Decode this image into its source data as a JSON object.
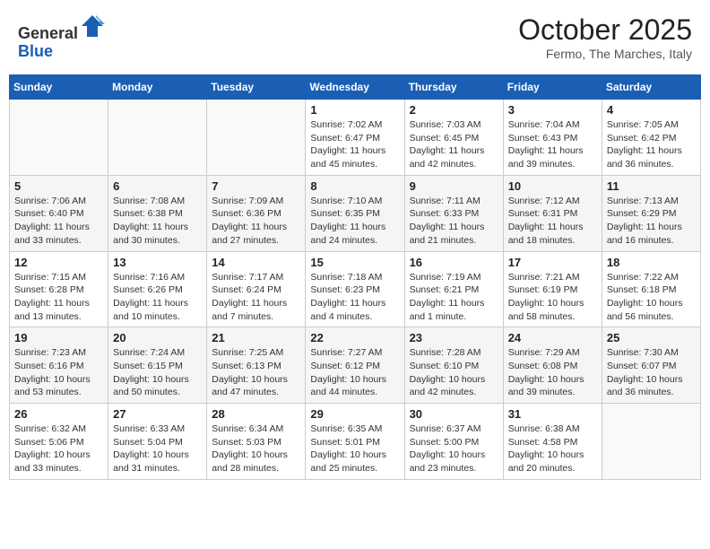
{
  "header": {
    "logo_line1": "General",
    "logo_line2": "Blue",
    "month": "October 2025",
    "location": "Fermo, The Marches, Italy"
  },
  "weekdays": [
    "Sunday",
    "Monday",
    "Tuesday",
    "Wednesday",
    "Thursday",
    "Friday",
    "Saturday"
  ],
  "weeks": [
    [
      {
        "day": "",
        "info": ""
      },
      {
        "day": "",
        "info": ""
      },
      {
        "day": "",
        "info": ""
      },
      {
        "day": "1",
        "info": "Sunrise: 7:02 AM\nSunset: 6:47 PM\nDaylight: 11 hours and 45 minutes."
      },
      {
        "day": "2",
        "info": "Sunrise: 7:03 AM\nSunset: 6:45 PM\nDaylight: 11 hours and 42 minutes."
      },
      {
        "day": "3",
        "info": "Sunrise: 7:04 AM\nSunset: 6:43 PM\nDaylight: 11 hours and 39 minutes."
      },
      {
        "day": "4",
        "info": "Sunrise: 7:05 AM\nSunset: 6:42 PM\nDaylight: 11 hours and 36 minutes."
      }
    ],
    [
      {
        "day": "5",
        "info": "Sunrise: 7:06 AM\nSunset: 6:40 PM\nDaylight: 11 hours and 33 minutes."
      },
      {
        "day": "6",
        "info": "Sunrise: 7:08 AM\nSunset: 6:38 PM\nDaylight: 11 hours and 30 minutes."
      },
      {
        "day": "7",
        "info": "Sunrise: 7:09 AM\nSunset: 6:36 PM\nDaylight: 11 hours and 27 minutes."
      },
      {
        "day": "8",
        "info": "Sunrise: 7:10 AM\nSunset: 6:35 PM\nDaylight: 11 hours and 24 minutes."
      },
      {
        "day": "9",
        "info": "Sunrise: 7:11 AM\nSunset: 6:33 PM\nDaylight: 11 hours and 21 minutes."
      },
      {
        "day": "10",
        "info": "Sunrise: 7:12 AM\nSunset: 6:31 PM\nDaylight: 11 hours and 18 minutes."
      },
      {
        "day": "11",
        "info": "Sunrise: 7:13 AM\nSunset: 6:29 PM\nDaylight: 11 hours and 16 minutes."
      }
    ],
    [
      {
        "day": "12",
        "info": "Sunrise: 7:15 AM\nSunset: 6:28 PM\nDaylight: 11 hours and 13 minutes."
      },
      {
        "day": "13",
        "info": "Sunrise: 7:16 AM\nSunset: 6:26 PM\nDaylight: 11 hours and 10 minutes."
      },
      {
        "day": "14",
        "info": "Sunrise: 7:17 AM\nSunset: 6:24 PM\nDaylight: 11 hours and 7 minutes."
      },
      {
        "day": "15",
        "info": "Sunrise: 7:18 AM\nSunset: 6:23 PM\nDaylight: 11 hours and 4 minutes."
      },
      {
        "day": "16",
        "info": "Sunrise: 7:19 AM\nSunset: 6:21 PM\nDaylight: 11 hours and 1 minute."
      },
      {
        "day": "17",
        "info": "Sunrise: 7:21 AM\nSunset: 6:19 PM\nDaylight: 10 hours and 58 minutes."
      },
      {
        "day": "18",
        "info": "Sunrise: 7:22 AM\nSunset: 6:18 PM\nDaylight: 10 hours and 56 minutes."
      }
    ],
    [
      {
        "day": "19",
        "info": "Sunrise: 7:23 AM\nSunset: 6:16 PM\nDaylight: 10 hours and 53 minutes."
      },
      {
        "day": "20",
        "info": "Sunrise: 7:24 AM\nSunset: 6:15 PM\nDaylight: 10 hours and 50 minutes."
      },
      {
        "day": "21",
        "info": "Sunrise: 7:25 AM\nSunset: 6:13 PM\nDaylight: 10 hours and 47 minutes."
      },
      {
        "day": "22",
        "info": "Sunrise: 7:27 AM\nSunset: 6:12 PM\nDaylight: 10 hours and 44 minutes."
      },
      {
        "day": "23",
        "info": "Sunrise: 7:28 AM\nSunset: 6:10 PM\nDaylight: 10 hours and 42 minutes."
      },
      {
        "day": "24",
        "info": "Sunrise: 7:29 AM\nSunset: 6:08 PM\nDaylight: 10 hours and 39 minutes."
      },
      {
        "day": "25",
        "info": "Sunrise: 7:30 AM\nSunset: 6:07 PM\nDaylight: 10 hours and 36 minutes."
      }
    ],
    [
      {
        "day": "26",
        "info": "Sunrise: 6:32 AM\nSunset: 5:06 PM\nDaylight: 10 hours and 33 minutes."
      },
      {
        "day": "27",
        "info": "Sunrise: 6:33 AM\nSunset: 5:04 PM\nDaylight: 10 hours and 31 minutes."
      },
      {
        "day": "28",
        "info": "Sunrise: 6:34 AM\nSunset: 5:03 PM\nDaylight: 10 hours and 28 minutes."
      },
      {
        "day": "29",
        "info": "Sunrise: 6:35 AM\nSunset: 5:01 PM\nDaylight: 10 hours and 25 minutes."
      },
      {
        "day": "30",
        "info": "Sunrise: 6:37 AM\nSunset: 5:00 PM\nDaylight: 10 hours and 23 minutes."
      },
      {
        "day": "31",
        "info": "Sunrise: 6:38 AM\nSunset: 4:58 PM\nDaylight: 10 hours and 20 minutes."
      },
      {
        "day": "",
        "info": ""
      }
    ]
  ]
}
